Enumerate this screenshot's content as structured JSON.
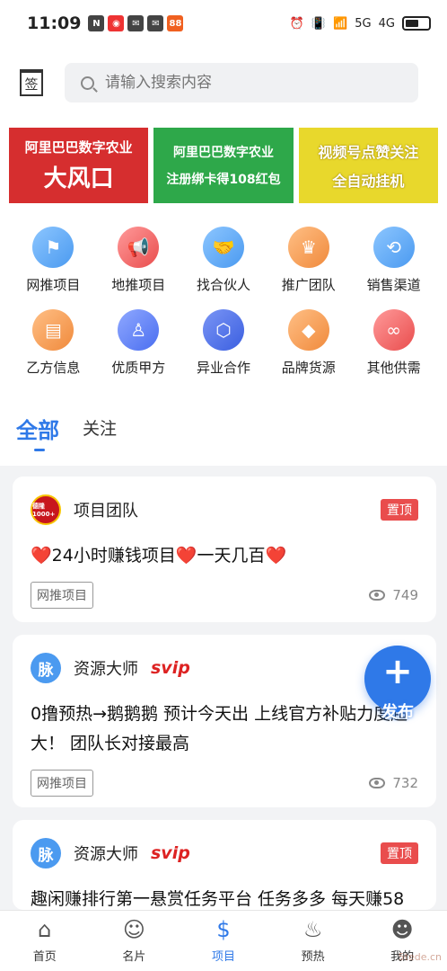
{
  "status": {
    "time": "11:09",
    "network_5g": "5G",
    "network_4g": "4G"
  },
  "header": {
    "sign_label": "签",
    "search_placeholder": "请输入搜索内容"
  },
  "banners": [
    {
      "line1": "阿里巴巴数字农业",
      "line2": "大风口"
    },
    {
      "line1": "阿里巴巴数字农业",
      "line2": "注册绑卡得108红包"
    },
    {
      "line1": "视频号点赞关注",
      "line2": "全自动挂机"
    }
  ],
  "categories": [
    {
      "label": "网推项目",
      "icon": "flag-icon",
      "color": "#5aa9f5"
    },
    {
      "label": "地推项目",
      "icon": "megaphone-icon",
      "color": "#ef5a5a"
    },
    {
      "label": "找合伙人",
      "icon": "handshake-icon",
      "color": "#4b9af0"
    },
    {
      "label": "推广团队",
      "icon": "crown-icon",
      "color": "#f08a3c"
    },
    {
      "label": "销售渠道",
      "icon": "share-icon",
      "color": "#4b9af0"
    },
    {
      "label": "乙方信息",
      "icon": "document-icon",
      "color": "#f08a3c"
    },
    {
      "label": "优质甲方",
      "icon": "person-icon",
      "color": "#4a6ef0"
    },
    {
      "label": "异业合作",
      "icon": "hexagon-icon",
      "color": "#3b5fe0"
    },
    {
      "label": "品牌货源",
      "icon": "diamond-icon",
      "color": "#f08a3c"
    },
    {
      "label": "其他供需",
      "icon": "infinity-icon",
      "color": "#ef5a5a"
    }
  ],
  "tabs": {
    "all": "全部",
    "follow": "关注"
  },
  "posts": [
    {
      "author": "项目团队",
      "avatar_text": "德隆 1000+",
      "pinned": "置顶",
      "title": "❤️24小时赚钱项目❤️一天几百❤️",
      "tag": "网推项目",
      "views": "749"
    },
    {
      "author": "资源大师",
      "avatar_text": "脉",
      "vip": "svip",
      "title": "0撸预热→鹅鹅鹅 预计今天出 上线官方补贴力度超大！ 团队长对接最高",
      "tag": "网推项目",
      "views": "732"
    },
    {
      "author": "资源大师",
      "avatar_text": "脉",
      "vip": "svip",
      "pinned": "置顶",
      "title": "趣闲赚排行第一悬赏任务平台 任务多多 每天赚58"
    }
  ],
  "fab": {
    "plus": "+",
    "label": "发布"
  },
  "tabbar": [
    {
      "label": "首页",
      "icon": "home-icon"
    },
    {
      "label": "名片",
      "icon": "chat-icon"
    },
    {
      "label": "项目",
      "icon": "dollar-icon"
    },
    {
      "label": "预热",
      "icon": "flame-icon"
    },
    {
      "label": "我的",
      "icon": "user-icon"
    }
  ],
  "watermark": "5tede.cn"
}
